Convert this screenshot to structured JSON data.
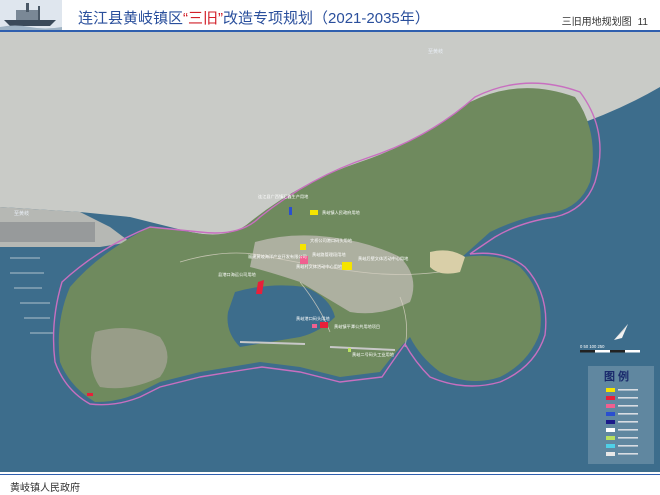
{
  "header": {
    "title_pre": "连江县黄岐镇区",
    "title_hl": "“三旧”",
    "title_post": "改造专项规划（2021-2035年）",
    "section": "三旧用地规划图",
    "page_number": "11"
  },
  "footer": {
    "text": "黄岐镇人民政府"
  },
  "colors": {
    "accent": "#2f5fae",
    "highlight": "#d2202a",
    "sea": "#3d6d8c",
    "land": "#6f8a5e",
    "boundary": "#c86fc0"
  },
  "map": {
    "place_labels": [
      {
        "id": "north-town",
        "text": "至黄岐"
      },
      {
        "id": "west-town",
        "text": "至黄岐"
      }
    ],
    "site_labels": [
      {
        "id": "site-1",
        "text": "连江县广西镇汇鑫生产用地"
      },
      {
        "id": "site-2",
        "text": "黄岐镇人民政府用地"
      },
      {
        "id": "site-3",
        "text": "大桥公司港口码头用地"
      },
      {
        "id": "site-4",
        "text": "黄岐路管理段用地"
      },
      {
        "id": "site-5",
        "text": "福建黄岐海洋产业开发有限公司"
      },
      {
        "id": "site-6",
        "text": "黄岐村文体活动中心用地"
      },
      {
        "id": "site-7",
        "text": "黄岐后壁文体活动中心用地"
      },
      {
        "id": "site-8",
        "text": "县港口海运公司用地"
      },
      {
        "id": "site-9",
        "text": "黄岐港口码头用地"
      },
      {
        "id": "site-10",
        "text": "黄岐镇平潭公共用地项目"
      },
      {
        "id": "site-11",
        "text": "黄岐二号码头工业用地"
      }
    ],
    "scale_label": "0  50 100     250",
    "legend": {
      "title": "图 例",
      "items": [
        {
          "color": "#f5e400"
        },
        {
          "color": "#e8203a"
        },
        {
          "color": "#f06090"
        },
        {
          "color": "#2a4fd0"
        },
        {
          "color": "#1a1a8a"
        },
        {
          "color": "#ffffff"
        },
        {
          "color": "#b8e060"
        },
        {
          "color": "#4fd0e8"
        },
        {
          "color": "#e8e8e8"
        }
      ]
    }
  }
}
